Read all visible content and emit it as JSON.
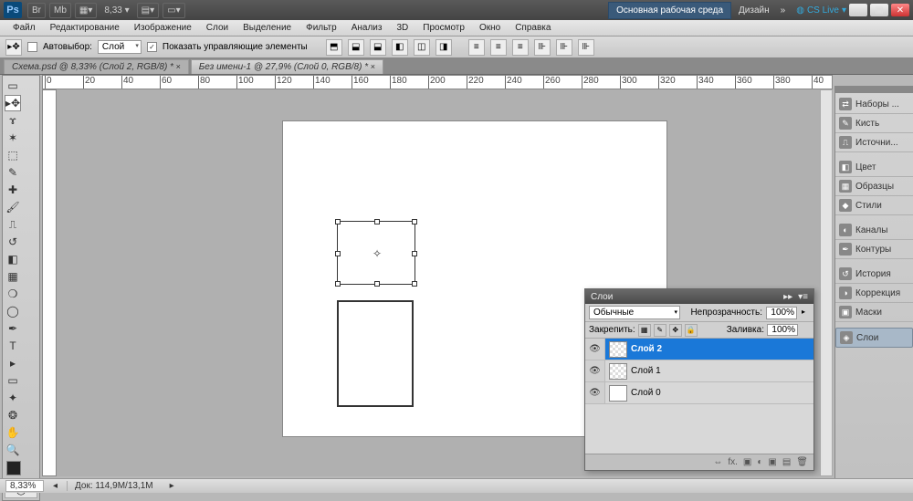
{
  "app": {
    "logo": "Ps",
    "zoom_display": "8,33",
    "workspace_main": "Основная рабочая среда",
    "workspace_design": "Дизайн",
    "cslive": "CS Live"
  },
  "topbar_icons": [
    "Br",
    "Mb"
  ],
  "menu": [
    "Файл",
    "Редактирование",
    "Изображение",
    "Слои",
    "Выделение",
    "Фильтр",
    "Анализ",
    "3D",
    "Просмотр",
    "Окно",
    "Справка"
  ],
  "options": {
    "autoselect_label": "Автовыбор:",
    "autoselect_value": "Слой",
    "show_controls_label": "Показать управляющие элементы",
    "show_controls_checked": "✓"
  },
  "tabs": [
    {
      "label": "Схема.psd @ 8,33% (Слой 2, RGB/8) *",
      "active": true
    },
    {
      "label": "Без имени-1 @ 27,9% (Слой 0, RGB/8) *",
      "active": false
    }
  ],
  "ruler_ticks": [
    "0",
    "20",
    "40",
    "60",
    "80",
    "100",
    "120",
    "140",
    "160",
    "180",
    "200",
    "220",
    "240",
    "260",
    "280",
    "300",
    "320",
    "340",
    "360",
    "380",
    "40"
  ],
  "right_panels": [
    "Наборы ...",
    "Кисть",
    "Источни...",
    "Цвет",
    "Образцы",
    "Стили",
    "Каналы",
    "Контуры",
    "История",
    "Коррекция",
    "Маски",
    "Слои"
  ],
  "layers_panel": {
    "title": "Слои",
    "blend_mode": "Обычные",
    "opacity_label": "Непрозрачность:",
    "opacity_value": "100%",
    "lock_label": "Закрепить:",
    "fill_label": "Заливка:",
    "fill_value": "100%",
    "layers": [
      {
        "name": "Слой 2",
        "selected": true,
        "transparent": true
      },
      {
        "name": "Слой 1",
        "selected": false,
        "transparent": true
      },
      {
        "name": "Слой 0",
        "selected": false,
        "transparent": false
      }
    ]
  },
  "status": {
    "zoom": "8,33%",
    "doc_label": "Док:",
    "doc_value": "114,9M/13,1M"
  }
}
